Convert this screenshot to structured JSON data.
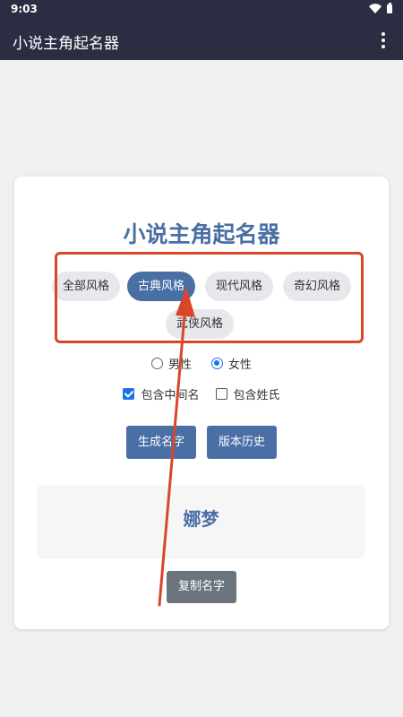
{
  "status_bar": {
    "time": "9:03"
  },
  "app_bar": {
    "title": "小说主角起名器",
    "menu_icon": "more-vert-icon"
  },
  "main": {
    "title": "小说主角起名器",
    "styles": [
      {
        "label": "全部风格",
        "active": false
      },
      {
        "label": "古典风格",
        "active": true
      },
      {
        "label": "现代风格",
        "active": false
      },
      {
        "label": "奇幻风格",
        "active": false
      },
      {
        "label": "武侠风格",
        "active": false
      }
    ],
    "gender": {
      "options": [
        "男性",
        "女性"
      ],
      "selected": "女性"
    },
    "options": {
      "middle_name": {
        "label": "包含中间名",
        "checked": true
      },
      "surname": {
        "label": "包含姓氏",
        "checked": false
      }
    },
    "buttons": {
      "generate": "生成名字",
      "history": "版本历史"
    },
    "result": "娜梦",
    "copy_button": "复制名字"
  },
  "colors": {
    "accent": "#4a6fa5",
    "header_bg": "#2b2d42",
    "annotation": "#d9472b",
    "copy_button": "#6c757d"
  }
}
